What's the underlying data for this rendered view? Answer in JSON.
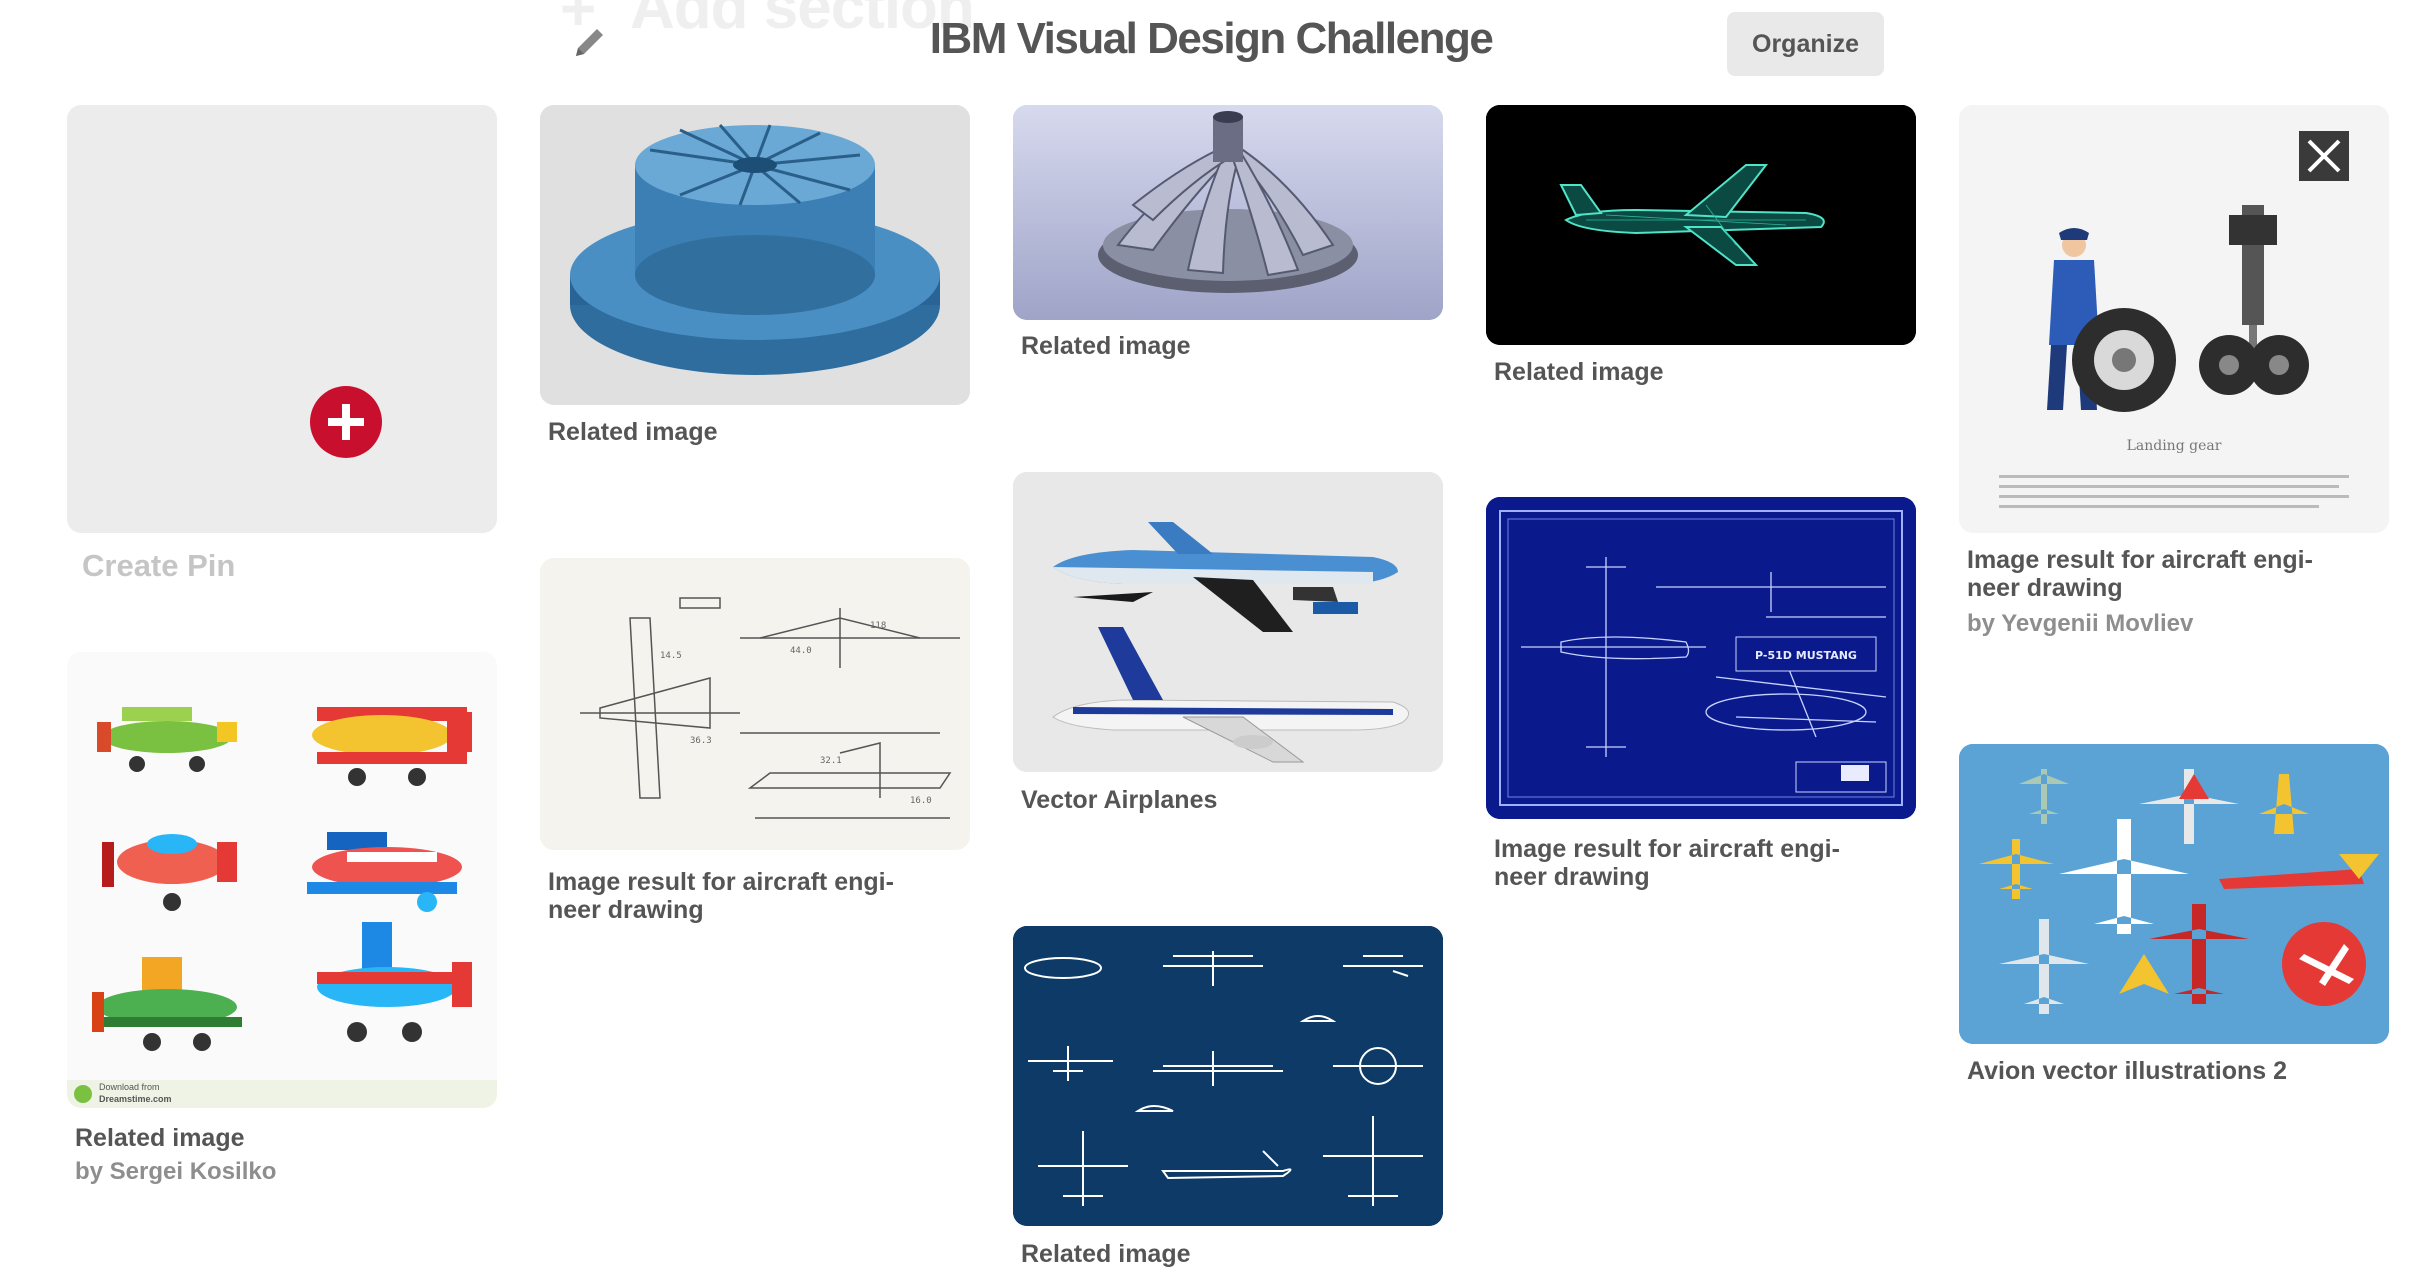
{
  "header": {
    "ghost_add_section": "Add section",
    "board_title": "IBM Visual Design Challenge",
    "organize_label": "Organize"
  },
  "create_pin": {
    "label": "Create Pin"
  },
  "pins": [
    {
      "id": "fan-shroud",
      "caption": "Related image",
      "byline": ""
    },
    {
      "id": "turbine-impeller",
      "caption": "Related image",
      "byline": ""
    },
    {
      "id": "wireframe-jet",
      "caption": "Related image",
      "byline": ""
    },
    {
      "id": "landing-gear",
      "caption": "Image result for aircraft engi-\nneer drawing",
      "byline": "by Yevgenii Movliev",
      "inner_label": "Landing gear"
    },
    {
      "id": "cartoon-planes",
      "caption": "Related image",
      "byline": "by Sergei Kosilko",
      "watermark": "Download from\nDreamstime.com"
    },
    {
      "id": "sketch-drawing",
      "caption": "Image result for aircraft engi-\nneer drawing",
      "byline": ""
    },
    {
      "id": "vector-airplanes",
      "caption": "Vector Airplanes",
      "byline": ""
    },
    {
      "id": "p51-blueprint",
      "caption": "Image result for aircraft engi-\nneer drawing",
      "byline": "",
      "inner_label": "P-51D MUSTANG"
    },
    {
      "id": "icons-blue",
      "caption": "Related image",
      "byline": ""
    },
    {
      "id": "avion-vector",
      "caption": "Avion vector illustrations 2",
      "byline": ""
    }
  ],
  "colors": {
    "brand_red": "#c8102e",
    "organize_bg": "#e9e9e9",
    "blueprint_bg": "#0a1a8c",
    "icons_bg": "#0d3a66",
    "avion_bg": "#5ba3d4"
  }
}
